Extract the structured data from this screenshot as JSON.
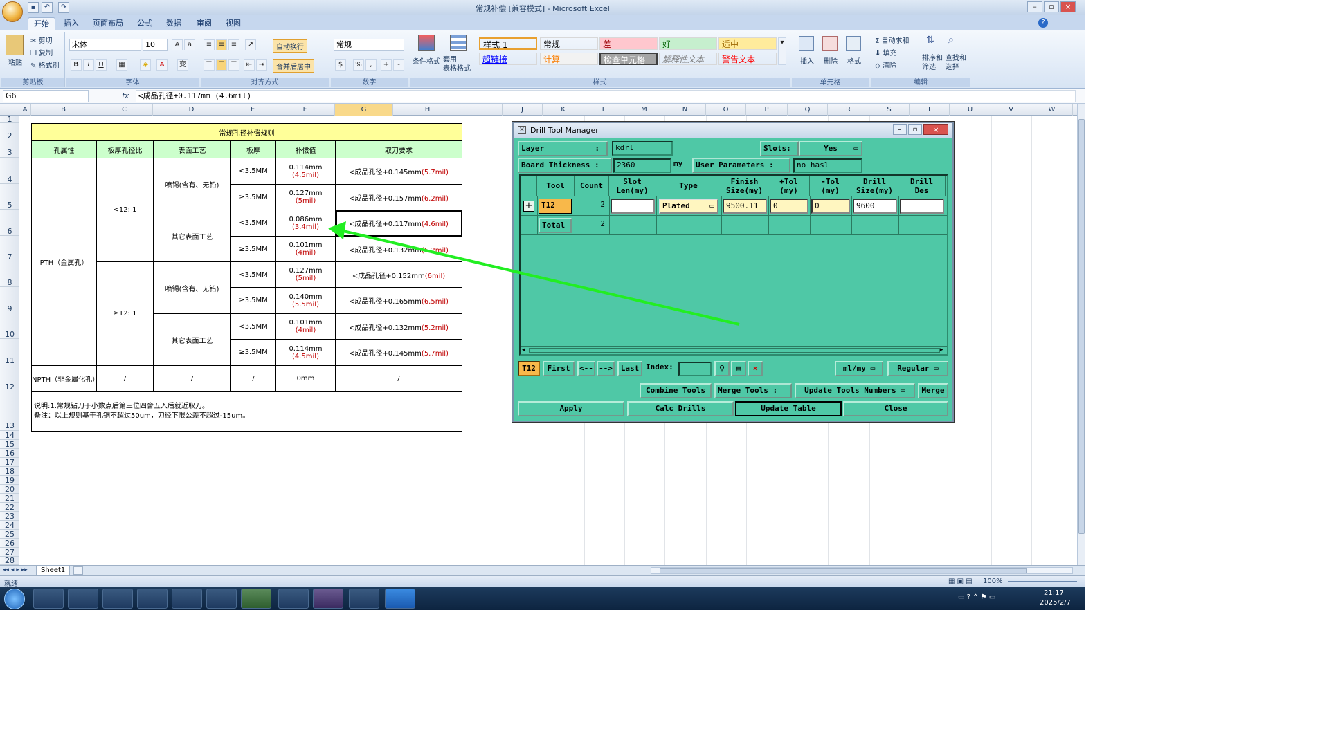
{
  "window": {
    "title": "常规补偿 [兼容模式] - Microsoft Excel"
  },
  "tabs": [
    "开始",
    "插入",
    "页面布局",
    "公式",
    "数据",
    "审阅",
    "视图"
  ],
  "ribbon": {
    "clipboard": {
      "cut": "剪切",
      "copy": "复制",
      "format_painter": "格式刷",
      "paste": "粘贴",
      "label": "剪贴板"
    },
    "font": {
      "name": "宋体",
      "size": "10",
      "label": "字体"
    },
    "alignment": {
      "wrap": "自动换行",
      "merge": "合并后居中",
      "label": "对齐方式"
    },
    "number": {
      "format": "常规",
      "label": "数字"
    },
    "styles": {
      "cond_format": "条件格式",
      "table_format": "套用\n表格格式",
      "label": "样式",
      "cells": [
        {
          "text": "样式 1",
          "bg": "#ffffff",
          "color": "#000000"
        },
        {
          "text": "常规",
          "bg": "#ffffff",
          "color": "#000000"
        },
        {
          "text": "差",
          "bg": "#ffc7ce",
          "color": "#9c0006"
        },
        {
          "text": "好",
          "bg": "#c6efce",
          "color": "#006100"
        },
        {
          "text": "适中",
          "bg": "#ffeb9c",
          "color": "#9c6500"
        },
        {
          "text": "超链接",
          "bg": "#ffffff",
          "color": "#0000ff"
        },
        {
          "text": "计算",
          "bg": "#f2f2f2",
          "color": "#fa7d00"
        },
        {
          "text": "检查单元格",
          "bg": "#a5a5a5",
          "color": "#ffffff"
        },
        {
          "text": "解释性文本",
          "bg": "#ffffff",
          "color": "#7f7f7f"
        },
        {
          "text": "警告文本",
          "bg": "#ffffff",
          "color": "#ff0000"
        }
      ]
    },
    "cells_group": {
      "insert": "插入",
      "delete": "删除",
      "format": "格式",
      "label": "单元格"
    },
    "editing": {
      "autosum": "自动求和",
      "fill": "填充",
      "clear": "清除",
      "sort": "排序和\n筛选",
      "find": "查找和\n选择",
      "label": "编辑"
    }
  },
  "formula_bar": {
    "name_box": "G6",
    "fx": "fx",
    "content": "<成品孔径+0.117mm (4.6mil)"
  },
  "columns": [
    "A",
    "B",
    "C",
    "D",
    "E",
    "F",
    "G",
    "H",
    "I",
    "J",
    "K",
    "L",
    "M",
    "N",
    "O",
    "P",
    "Q",
    "R",
    "S",
    "T",
    "U",
    "V",
    "W"
  ],
  "rows": [
    "1",
    "2",
    "3",
    "4",
    "5",
    "6",
    "7",
    "8",
    "9",
    "10",
    "11",
    "12",
    "13",
    "14",
    "15",
    "16",
    "17",
    "18",
    "19",
    "20",
    "21",
    "22",
    "23",
    "24",
    "25",
    "26",
    "27",
    "28"
  ],
  "sheet": {
    "title": "常规孔径补偿规则",
    "headers": [
      "孔属性",
      "板厚孔径比",
      "表面工艺",
      "板厚",
      "补偿值",
      "取刀要求"
    ],
    "pth": "PTH（金属孔）",
    "ratio_lt": "<12: 1",
    "ratio_ge": "≥12: 1",
    "proc_hasl": "喷锡(含有、无铅)",
    "proc_other": "其它表面工艺",
    "rows": [
      {
        "thick": "<3.5MM",
        "comp": "0.114mm",
        "comp_mil": "(4.5mil)",
        "req": "<成品孔径+0.145mm",
        "req_mil": "(5.7mil)"
      },
      {
        "thick": "≥3.5MM",
        "comp": "0.127mm",
        "comp_mil": "(5mil)",
        "req": "<成品孔径+0.157mm",
        "req_mil": "(6.2mil)"
      },
      {
        "thick": "<3.5MM",
        "comp": "0.086mm",
        "comp_mil": "(3.4mil)",
        "req": "<成品孔径+0.117mm",
        "req_mil": "(4.6mil)"
      },
      {
        "thick": "≥3.5MM",
        "comp": "0.101mm",
        "comp_mil": "(4mil)",
        "req": "<成品孔径+0.132mm",
        "req_mil": "(5.2mil)"
      },
      {
        "thick": "<3.5MM",
        "comp": "0.127mm",
        "comp_mil": "(5mil)",
        "req": "<成品孔径+0.152mm",
        "req_mil": "(6mil)"
      },
      {
        "thick": "≥3.5MM",
        "comp": "0.140mm",
        "comp_mil": "(5.5mil)",
        "req": "<成品孔径+0.165mm",
        "req_mil": "(6.5mil)"
      },
      {
        "thick": "<3.5MM",
        "comp": "0.101mm",
        "comp_mil": "(4mil)",
        "req": "<成品孔径+0.132mm",
        "req_mil": "(5.2mil)"
      },
      {
        "thick": "≥3.5MM",
        "comp": "0.114mm",
        "comp_mil": "(4.5mil)",
        "req": "<成品孔径+0.145mm",
        "req_mil": "(5.7mil)"
      }
    ],
    "npth": {
      "attr": "NPTH（非金属化孔）",
      "ratio": "/",
      "proc": "/",
      "thick": "/",
      "comp": "0mm",
      "req": "/"
    },
    "note1": "说明:1.常规钻刀于小数点后第三位四舍五入后就近取刀。",
    "note2": "备注：以上规则基于孔铜不超过50um，刀径下限公差不超过-15um。"
  },
  "dialog": {
    "title": "Drill Tool Manager",
    "layer_label": "Layer",
    "layer_colon": ":",
    "layer_value": "kdrl",
    "slots_label": "Slots:",
    "slots_value": "Yes",
    "board_label": "Board Thickness  :",
    "board_value": "2360",
    "board_unit": "my",
    "user_params_label": "User Parameters :",
    "user_params_value": "no_hasl",
    "headers": [
      "Tool",
      "Count",
      "Slot\nLen(my)",
      "Type",
      "Finish\nSize(my)",
      "+Tol\n(my)",
      "-Tol\n(my)",
      "Drill\nSize(my)",
      "Drill\nDes"
    ],
    "row": {
      "tool": "T12",
      "count": "2",
      "slot": "",
      "type": "Plated",
      "finish": "9500.11",
      "ptol": "0",
      "ntol": "0",
      "drill": "9600",
      "des": ""
    },
    "total_label": "Total",
    "total_count": "2",
    "nav": {
      "current": "T12",
      "first": "First",
      "prev": "<--",
      "next": "-->",
      "last": "Last",
      "index_label": "Index:",
      "index_value": "",
      "units": "ml/my",
      "mode": "Regular"
    },
    "buttons": {
      "combine": "Combine Tools",
      "merge_label": "Merge Tools :",
      "update_numbers": "Update Tools Numbers",
      "merge": "Merge",
      "apply": "Apply",
      "calc": "Calc Drills",
      "update_table": "Update Table",
      "close": "Close"
    }
  },
  "sheet_tab": "Sheet1",
  "status": {
    "ready": "就绪",
    "zoom": "100%"
  },
  "clock": {
    "time": "21:17",
    "date": "2025/2/7"
  },
  "colors": {
    "dialog_bg": "#4fc8a6",
    "arrow": "#22ee22",
    "title_yellow": "#ffff99",
    "header_green": "#ccffcc",
    "highlight_orange": "#f8b84a"
  }
}
